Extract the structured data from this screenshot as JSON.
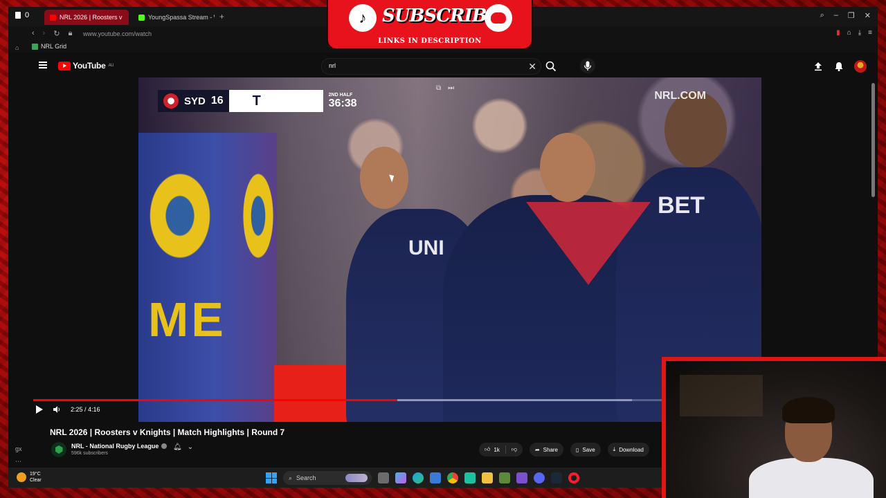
{
  "browser": {
    "counter": "0",
    "tabs": [
      {
        "label": "NRL 2026 | Roosters v",
        "color": "#ff0000"
      },
      {
        "label": "YoungSpassa Stream - Wo",
        "color": "#53fc18"
      }
    ],
    "url": "www.youtube.com/watch",
    "bookmark": "NRL Grid"
  },
  "youtube": {
    "logo_text": "YouTube",
    "region": "AU",
    "search_value": "nrl"
  },
  "video": {
    "scorebug": {
      "team": "SYD",
      "score": "16",
      "opponent_partial": "T",
      "half": "2ND HALF",
      "clock": "36:38"
    },
    "watermark": "NRL.COM",
    "jersey_text_1": "UNI",
    "jersey_text_2": "BET",
    "pad_text": "ME"
  },
  "player": {
    "time": "2:25 / 4:16",
    "progress": 0.566,
    "buffered_to": 0.93
  },
  "info": {
    "title": "NRL 2026 | Roosters v Knights | Match Highlights | Round 7",
    "channel": "NRL - National Rugby League",
    "subscribers": "596k subscribers",
    "likes": "1k",
    "share": "Share",
    "save": "Save",
    "download": "Download"
  },
  "taskbar": {
    "temp": "19°C",
    "weather": "Clear",
    "search": "Search"
  },
  "overlay": {
    "subscribe": "SUBSCRIBE",
    "links": "LINKS IN DESCRIPTION"
  },
  "colors": {
    "accent": "#ff0000",
    "frame": "#d41010",
    "page_bg": "#0f0f0f"
  }
}
